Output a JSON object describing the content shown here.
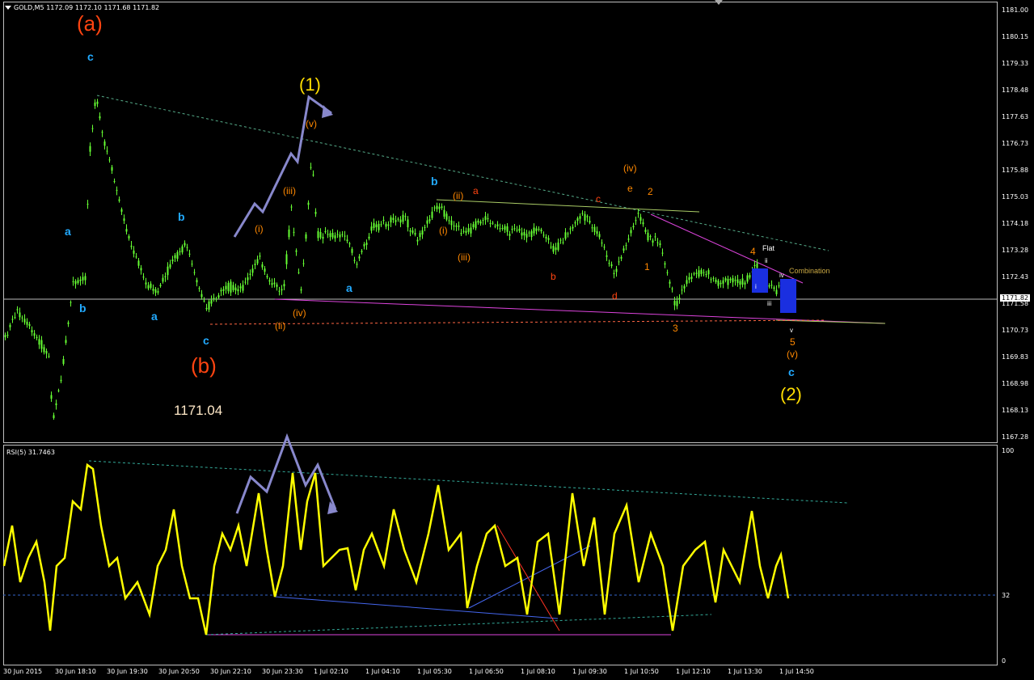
{
  "header": {
    "symbol_menu_icon": "triangle-down-icon",
    "title": "GOLD,M5  1172.09 1172.10 1171.68 1171.82"
  },
  "main_chart": {
    "current_price_tag": "1171.82",
    "price_axis_labels": [
      "1181.00",
      "1180.15",
      "1179.33",
      "1178.48",
      "1177.63",
      "1176.73",
      "1175.88",
      "1175.03",
      "1174.18",
      "1173.28",
      "1172.43",
      "1171.58",
      "1170.73",
      "1169.83",
      "1168.98",
      "1168.13",
      "1167.28"
    ],
    "big_value_annotation": "1171.04",
    "colors": {
      "candle": "#66ff33",
      "wave_blue": "#22aaff",
      "wave_red": "#ff4411",
      "wave_orange": "#ff8800",
      "wave_yellow": "#ffdd00",
      "arrow": "#8888cc",
      "trend_magenta": "#ff33ff",
      "trend_green": "#99dd77"
    },
    "wave_labels": [
      {
        "text": "(a)",
        "color": "red"
      },
      {
        "text": "(b)",
        "color": "red"
      },
      {
        "text": "(1)",
        "color": "yellow"
      },
      {
        "text": "(2)",
        "color": "yellow"
      },
      {
        "text": "c",
        "color": "blue"
      },
      {
        "text": "a",
        "color": "blue"
      },
      {
        "text": "b",
        "color": "blue"
      },
      {
        "text": "b",
        "color": "blue"
      },
      {
        "text": "a",
        "color": "blue"
      },
      {
        "text": "c",
        "color": "blue"
      },
      {
        "text": "a",
        "color": "blue"
      },
      {
        "text": "b",
        "color": "blue"
      },
      {
        "text": "c",
        "color": "blue"
      },
      {
        "text": "(i)",
        "color": "orange"
      },
      {
        "text": "(ii)",
        "color": "orange"
      },
      {
        "text": "(iii)",
        "color": "orange"
      },
      {
        "text": "(iv)",
        "color": "orange"
      },
      {
        "text": "(v)",
        "color": "orange"
      },
      {
        "text": "(i)",
        "color": "orange"
      },
      {
        "text": "(ii)",
        "color": "orange"
      },
      {
        "text": "(iii)",
        "color": "orange"
      },
      {
        "text": "(iv)",
        "color": "orange"
      },
      {
        "text": "(v)",
        "color": "orange"
      },
      {
        "text": "a",
        "color": "red"
      },
      {
        "text": "b",
        "color": "red"
      },
      {
        "text": "c",
        "color": "red"
      },
      {
        "text": "d",
        "color": "red"
      },
      {
        "text": "e",
        "color": "orange"
      },
      {
        "text": "1",
        "color": "orange"
      },
      {
        "text": "2",
        "color": "orange"
      },
      {
        "text": "3",
        "color": "orange"
      },
      {
        "text": "4",
        "color": "orange"
      },
      {
        "text": "5",
        "color": "orange"
      },
      {
        "text": "Flat",
        "color": "white"
      },
      {
        "text": "Combination",
        "color": "olive"
      },
      {
        "text": "ii",
        "color": "white"
      },
      {
        "text": "iii",
        "color": "white"
      },
      {
        "text": "iv",
        "color": "white"
      },
      {
        "text": "v",
        "color": "white"
      },
      {
        "text": "i",
        "color": "white"
      }
    ]
  },
  "rsi_panel": {
    "title": "RSI(5) 31.7463",
    "scale_labels": [
      "100",
      "32",
      "0"
    ]
  },
  "time_axis": {
    "labels": [
      "30 Jun 2015",
      "30 Jun 18:10",
      "30 Jun 19:30",
      "30 Jun 20:50",
      "30 Jun 22:10",
      "30 Jun 23:30",
      "1 Jul 02:10",
      "1 Jul 04:10",
      "1 Jul 05:30",
      "1 Jul 06:50",
      "1 Jul 08:10",
      "1 Jul 09:30",
      "1 Jul 10:50",
      "1 Jul 12:10",
      "1 Jul 13:30",
      "1 Jul 14:50"
    ]
  }
}
